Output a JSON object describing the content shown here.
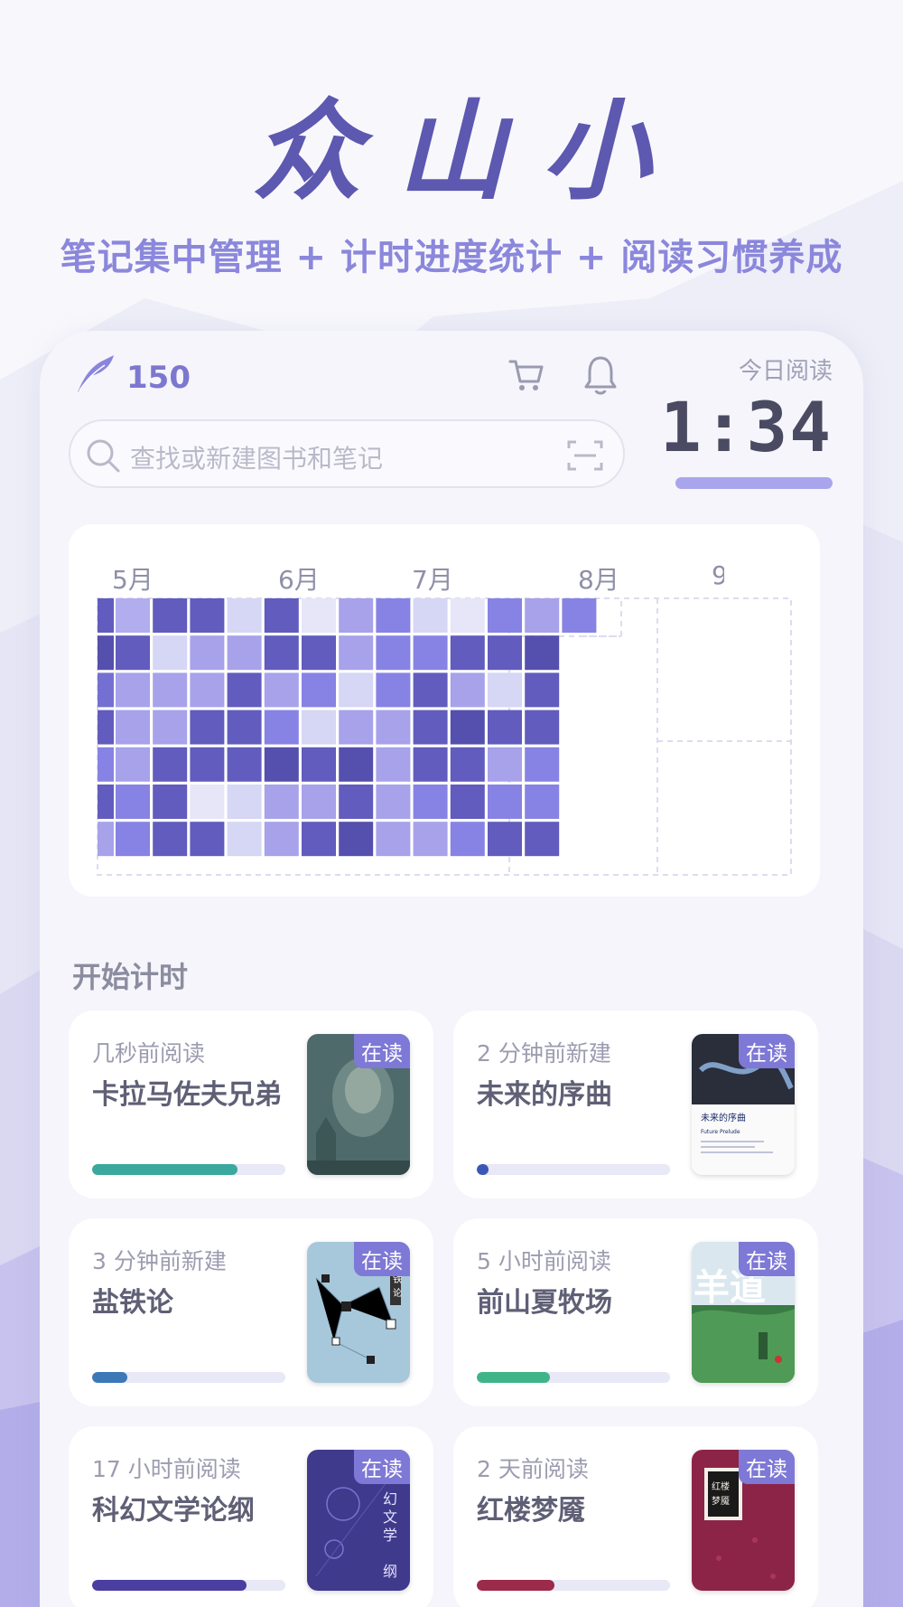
{
  "hero": {
    "logo": "众山小",
    "slogan": "笔记集中管理 + 计时进度统计 + 阅读习惯养成"
  },
  "topbar": {
    "points": "150",
    "today_label": "今日阅读",
    "timer": "1:34",
    "search_placeholder": "查找或新建图书和笔记"
  },
  "heatmap": {
    "months": [
      "5月",
      "6月",
      "7月",
      "8月",
      "9"
    ],
    "palette": [
      "#e6e6f8",
      "#d6d6f5",
      "#b1adee",
      "#a7a2ea",
      "#8783e4",
      "#7470d2",
      "#615cbd",
      "#554fae"
    ],
    "cells": [
      [
        6,
        2,
        6,
        6,
        1,
        6,
        0,
        3,
        4,
        1,
        0,
        4,
        3,
        4
      ],
      [
        7,
        6,
        1,
        3,
        3,
        6,
        6,
        3,
        4,
        4,
        6,
        6,
        7
      ],
      [
        5,
        3,
        3,
        3,
        6,
        3,
        4,
        1,
        4,
        6,
        3,
        1,
        6
      ],
      [
        6,
        3,
        3,
        6,
        6,
        4,
        1,
        3,
        3,
        6,
        7,
        6,
        6
      ],
      [
        4,
        3,
        6,
        6,
        6,
        7,
        6,
        7,
        3,
        6,
        6,
        3,
        4
      ],
      [
        6,
        4,
        6,
        0,
        1,
        3,
        3,
        6,
        3,
        4,
        6,
        4,
        4
      ],
      [
        3,
        4,
        6,
        6,
        1,
        3,
        6,
        7,
        3,
        3,
        4,
        6,
        6
      ]
    ]
  },
  "section": {
    "title": "开始计时"
  },
  "books": [
    {
      "time": "几秒前阅读",
      "title": "卡拉马佐夫兄弟",
      "badge": "在读",
      "progress": 0.75,
      "color": "#3aa89c",
      "cover": "karamazov"
    },
    {
      "time": "2 分钟前新建",
      "title": "未来的序曲",
      "badge": "在读",
      "progress": 0.03,
      "color": "#3b58b8",
      "cover": "future"
    },
    {
      "time": "3 分钟前新建",
      "title": "盐铁论",
      "badge": "在读",
      "progress": 0.18,
      "color": "#3c78b8",
      "cover": "salt"
    },
    {
      "time": "5 小时前阅读",
      "title": "前山夏牧场",
      "badge": "在读",
      "progress": 0.38,
      "color": "#3fb489",
      "cover": "pasture"
    },
    {
      "time": "17 小时前阅读",
      "title": "科幻文学论纲",
      "badge": "在读",
      "progress": 0.8,
      "color": "#4b3ea0",
      "cover": "scifi"
    },
    {
      "time": "2 天前阅读",
      "title": "红楼梦魇",
      "badge": "在读",
      "progress": 0.4,
      "color": "#9c2a4a",
      "cover": "hongloumeng"
    }
  ],
  "cover_texts": {
    "future_title": "未来的序曲",
    "future_sub": "Future Prelude",
    "salt_title": "盐铁论",
    "pasture_title": "羊道",
    "scifi_title": "科幻文学论纲",
    "hlm_title": "红楼梦魇"
  }
}
